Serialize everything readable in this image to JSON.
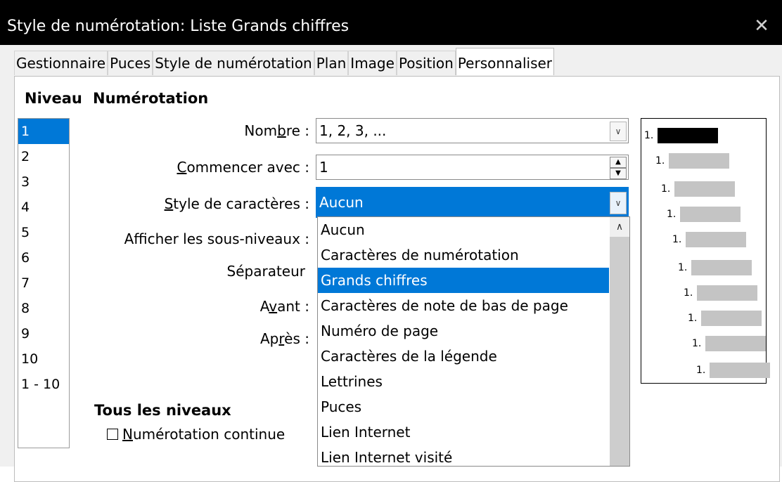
{
  "dialog": {
    "title": "Style de numérotation: Liste Grands chiffres"
  },
  "tabs": [
    {
      "label": "Gestionnaire"
    },
    {
      "label": "Puces"
    },
    {
      "label": "Style de numérotation"
    },
    {
      "label": "Plan"
    },
    {
      "label": "Image"
    },
    {
      "label": "Position"
    },
    {
      "label": "Personnaliser",
      "active": true
    }
  ],
  "headings": {
    "level": "Niveau",
    "numbering": "Numérotation",
    "all_levels": "Tous les niveaux"
  },
  "levels": [
    "1",
    "2",
    "3",
    "4",
    "5",
    "6",
    "7",
    "8",
    "9",
    "10",
    "1 - 10"
  ],
  "selected_level": "1",
  "fields": {
    "nombre": {
      "label_pre": "Nom",
      "label_u": "b",
      "label_post": "re :",
      "value": "1, 2, 3, ..."
    },
    "commencer": {
      "label_pre": "",
      "label_u": "C",
      "label_post": "ommencer avec :",
      "value": "1"
    },
    "style": {
      "label_pre": "",
      "label_u": "S",
      "label_post": "tyle de caractères :",
      "value": "Aucun"
    },
    "sous_niveaux": {
      "label_pre": "Af",
      "label_u": "f",
      "label_post": "icher les sous-niveaux :"
    },
    "separateur": {
      "label": "Séparateur"
    },
    "avant": {
      "label_pre": "A",
      "label_u": "v",
      "label_post": "ant :"
    },
    "apres": {
      "label_pre": "Ap",
      "label_u": "r",
      "label_post": "ès :"
    }
  },
  "continuous": {
    "label_u": "N",
    "label_post": "umérotation continue",
    "checked": false
  },
  "dropdown_options": [
    {
      "label": "Aucun"
    },
    {
      "label": "Caractères de numérotation"
    },
    {
      "label": "Grands chiffres",
      "selected": true
    },
    {
      "label": "Caractères de note de bas de page"
    },
    {
      "label": "Numéro de page"
    },
    {
      "label": "Caractères de la légende"
    },
    {
      "label": "Lettrines"
    },
    {
      "label": "Puces"
    },
    {
      "label": "Lien Internet"
    },
    {
      "label": "Lien Internet visité"
    }
  ],
  "preview": {
    "numbers": [
      "1.",
      "1.",
      "1.",
      "1.",
      "1.",
      "1.",
      "1.",
      "1.",
      "1.",
      "1."
    ]
  },
  "icons": {
    "close": "close-icon",
    "dropdown": "chevron-down-icon",
    "spin_up": "arrow-up-icon",
    "spin_down": "arrow-down-icon",
    "scroll_up": "chevron-up-icon"
  }
}
